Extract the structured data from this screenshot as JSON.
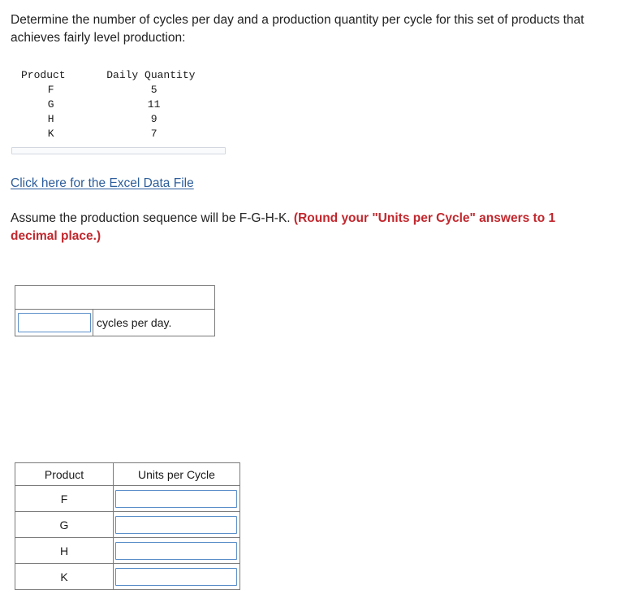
{
  "prompt": {
    "text": "Determine the number of cycles per day and a production quantity per cycle for this set of products that achieves fairly level production:"
  },
  "data_table": {
    "headers": [
      "Product",
      "Daily Quantity"
    ],
    "rows": [
      {
        "product": "F",
        "daily_quantity": "5"
      },
      {
        "product": "G",
        "daily_quantity": "11"
      },
      {
        "product": "H",
        "daily_quantity": "9"
      },
      {
        "product": "K",
        "daily_quantity": "7"
      }
    ]
  },
  "excel_link": {
    "label": "Click here for the Excel Data File"
  },
  "assume": {
    "lead": "Assume the production sequence will be F-G-H-K. ",
    "rounding": "(Round your \"Units per Cycle\" answers to 1 decimal place.)"
  },
  "cycles_answer": {
    "header": "",
    "input_value": "",
    "input_placeholder": "",
    "label": "cycles per day."
  },
  "units_table": {
    "headers": [
      "Product",
      "Units per Cycle"
    ],
    "rows": [
      {
        "product": "F",
        "units_per_cycle": "",
        "placeholder": ""
      },
      {
        "product": "G",
        "units_per_cycle": "",
        "placeholder": ""
      },
      {
        "product": "H",
        "units_per_cycle": "",
        "placeholder": ""
      },
      {
        "product": "K",
        "units_per_cycle": "",
        "placeholder": ""
      }
    ]
  },
  "colors": {
    "link": "#2c5d9b",
    "warning": "#c1272d",
    "input_border": "#5b8fc9",
    "table_border": "#7a7a7a"
  }
}
